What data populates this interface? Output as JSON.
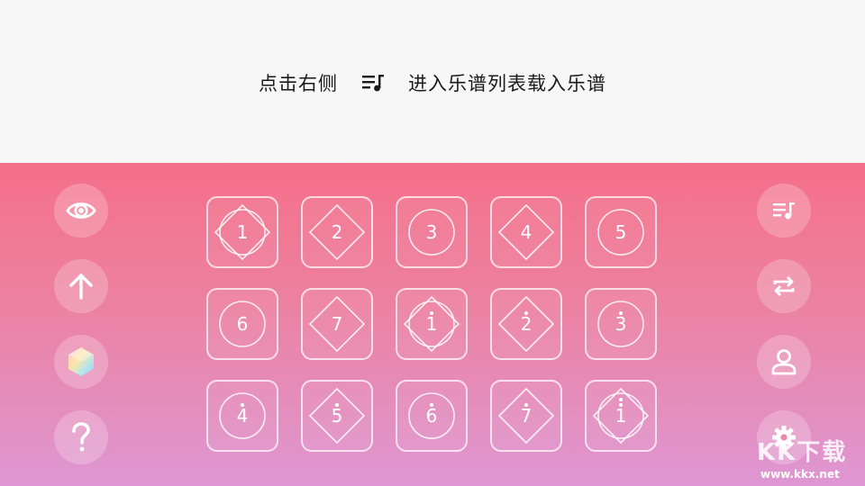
{
  "hint": {
    "before": "点击右侧",
    "after": "进入乐谱列表载入乐谱",
    "icon": "playlist-music-icon"
  },
  "left_buttons": [
    {
      "icon": "eye-icon"
    },
    {
      "icon": "arrow-up-icon"
    },
    {
      "icon": "hexagon-skin-icon"
    },
    {
      "icon": "question-icon"
    }
  ],
  "right_buttons": [
    {
      "icon": "playlist-music-icon"
    },
    {
      "icon": "repeat-icon"
    },
    {
      "icon": "user-icon"
    },
    {
      "icon": "gear-icon"
    }
  ],
  "pads": [
    {
      "note": "1",
      "dot": "none",
      "shape": "circle-diamond"
    },
    {
      "note": "2",
      "dot": "none",
      "shape": "diamond"
    },
    {
      "note": "3",
      "dot": "none",
      "shape": "circle"
    },
    {
      "note": "4",
      "dot": "none",
      "shape": "diamond"
    },
    {
      "note": "5",
      "dot": "none",
      "shape": "circle"
    },
    {
      "note": "6",
      "dot": "none",
      "shape": "circle"
    },
    {
      "note": "7",
      "dot": "none",
      "shape": "diamond"
    },
    {
      "note": "1",
      "dot": "above",
      "shape": "circle-diamond"
    },
    {
      "note": "2",
      "dot": "above",
      "shape": "diamond"
    },
    {
      "note": "3",
      "dot": "above",
      "shape": "circle"
    },
    {
      "note": "4",
      "dot": "above",
      "shape": "circle"
    },
    {
      "note": "5",
      "dot": "above",
      "shape": "diamond"
    },
    {
      "note": "6",
      "dot": "above",
      "shape": "circle"
    },
    {
      "note": "7",
      "dot": "above",
      "shape": "diamond"
    },
    {
      "note": "1",
      "dot": "double-above",
      "shape": "circle-diamond"
    }
  ],
  "watermark": {
    "logo": "KK下载",
    "url": "www.kkx.net"
  },
  "colors": {
    "gradient_top": "#f56f89",
    "gradient_bottom": "#de97d3",
    "top_bar": "#f7f7f7"
  }
}
